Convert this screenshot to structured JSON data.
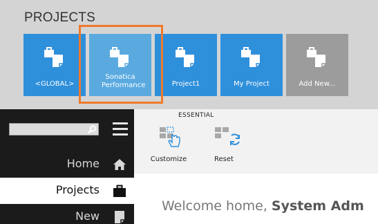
{
  "projects": {
    "title": "PROJECTS",
    "tiles": [
      {
        "label": "<GLOBAL>",
        "icon": "project-icon"
      },
      {
        "label": "Sonatica Performance",
        "icon": "project-icon",
        "selected": true
      },
      {
        "label": "Project1",
        "icon": "project-icon"
      },
      {
        "label": "My Project",
        "icon": "project-icon"
      },
      {
        "label": "Add New...",
        "icon": "project-icon"
      }
    ],
    "colors": {
      "tile": "#2e8fdb",
      "tile_selected": "#5aaae0",
      "tile_add": "#9c9c9c",
      "highlight": "#f0792b"
    }
  },
  "sidebar": {
    "search": {
      "value": "",
      "placeholder": ""
    },
    "items": [
      {
        "label": "Home",
        "icon": "home-icon"
      },
      {
        "label": "Projects",
        "icon": "briefcase-icon",
        "active": true
      },
      {
        "label": "New",
        "icon": "new-document-icon"
      }
    ]
  },
  "toolbar": {
    "group_label": "ESSENTIAL",
    "customize_label": "Customize",
    "reset_label": "Reset"
  },
  "main": {
    "welcome_prefix": "Welcome home, ",
    "welcome_name": "System Adm"
  }
}
